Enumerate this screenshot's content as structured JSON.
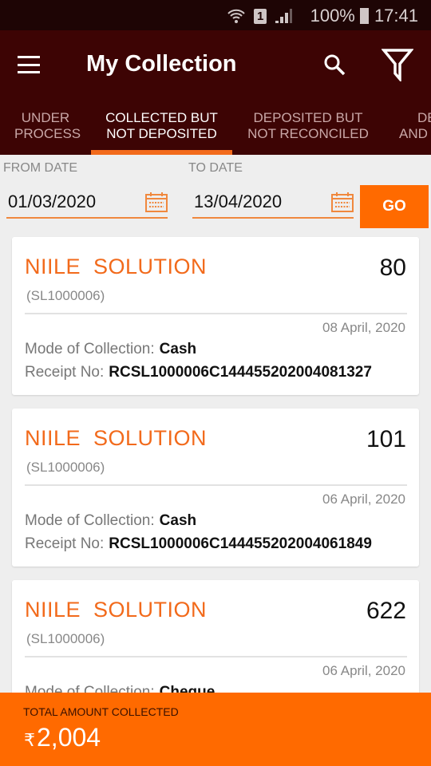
{
  "status_bar": {
    "battery": "100%",
    "time": "17:41",
    "sim": "1"
  },
  "app_bar": {
    "title": "My Collection"
  },
  "tabs": [
    {
      "l1": "UNDER",
      "l2": "PROCESS"
    },
    {
      "l1": "COLLECTED BUT",
      "l2": "NOT DEPOSITED"
    },
    {
      "l1": "DEPOSITED BUT",
      "l2": "NOT RECONCILED"
    },
    {
      "l1": "DE",
      "l2": "AND"
    }
  ],
  "filters": {
    "from_label": "FROM DATE",
    "from_value": "01/03/2020",
    "to_label": "TO DATE",
    "to_value": "13/04/2020",
    "go_label": "GO"
  },
  "labels": {
    "mode": "Mode of Collection:",
    "receipt": "Receipt No:"
  },
  "cards": [
    {
      "name": "NIILE  SOLUTION",
      "code": "(SL1000006)",
      "amount": "80",
      "date": "08 April, 2020",
      "mode": "Cash",
      "receipt": "RCSL1000006C144455202004081327"
    },
    {
      "name": "NIILE  SOLUTION",
      "code": "(SL1000006)",
      "amount": "101",
      "date": "06 April, 2020",
      "mode": "Cash",
      "receipt": "RCSL1000006C144455202004061849"
    },
    {
      "name": "NIILE  SOLUTION",
      "code": "(SL1000006)",
      "amount": "622",
      "date": "06 April, 2020",
      "mode": "Cheque"
    }
  ],
  "total": {
    "label": "TOTAL AMOUNT COLLECTED",
    "currency": "₹",
    "value": "2,004"
  },
  "colors": {
    "accent": "#ff6a00",
    "appbar": "#3d0404",
    "statusbar": "#1e0505"
  }
}
